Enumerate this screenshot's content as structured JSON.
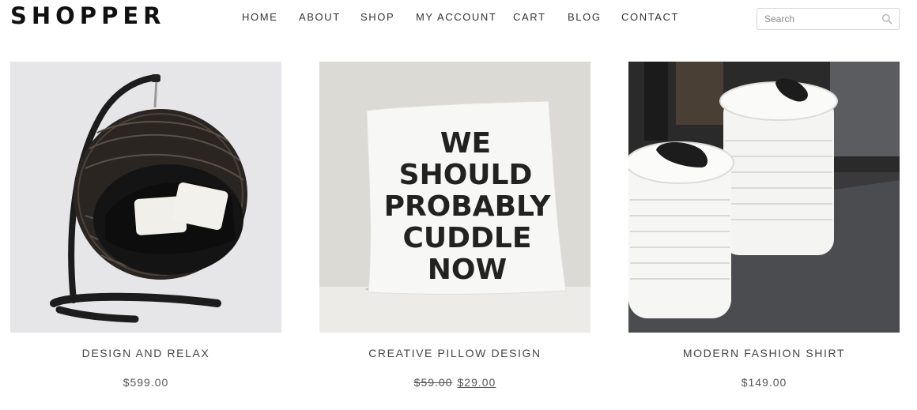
{
  "header": {
    "logo": "SHOPPER",
    "nav": [
      {
        "label": "HOME"
      },
      {
        "label": "ABOUT"
      },
      {
        "label": "SHOP"
      },
      {
        "label": "MY ACCOUNT"
      },
      {
        "label": "CART"
      },
      {
        "label": "BLOG"
      },
      {
        "label": "CONTACT"
      }
    ],
    "search": {
      "placeholder": "Search",
      "icon": "search-icon"
    }
  },
  "products": [
    {
      "name": "DESIGN AND RELAX",
      "price": "$599.00"
    },
    {
      "name": "CREATIVE PILLOW DESIGN",
      "old_price": "$59.00",
      "price": "$29.00",
      "pillow_text": [
        "WE",
        "SHOULD",
        "PROBABLY",
        "CUDDLE",
        "NOW"
      ]
    },
    {
      "name": "MODERN FASHION SHIRT",
      "price": "$149.00"
    }
  ]
}
